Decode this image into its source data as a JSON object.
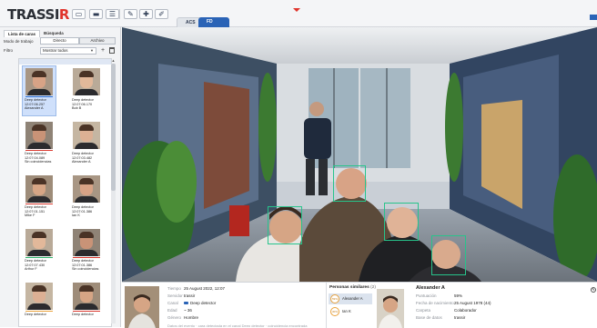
{
  "app": {
    "logo_main": "TRASSI",
    "logo_accent": "R"
  },
  "toolbar": {
    "buttons": [
      {
        "name": "layout-icon",
        "glyph": "▭"
      },
      {
        "name": "monitor-icon",
        "glyph": "▬"
      },
      {
        "name": "list-icon",
        "glyph": "☰"
      },
      {
        "name": "tools-icon",
        "glyph": "✎"
      },
      {
        "name": "puzzle-icon",
        "glyph": "✚"
      },
      {
        "name": "pencil-square-icon",
        "glyph": "✐"
      }
    ],
    "server_tabs": [
      "ACS",
      "FD"
    ]
  },
  "left_panel": {
    "tabs": [
      "Lista de caras",
      "Búsqueda"
    ],
    "mode_label": "Modo de trabajo",
    "mode_options": [
      "Directo",
      "Archivo"
    ],
    "filter_label": "Filtro",
    "filter_value": "Mostrar todos",
    "events": [
      {
        "line1": "Deep detector",
        "line2": "12:07:06.257",
        "line3": "Alexander A",
        "status_color": "#2f6fd0",
        "selected": true
      },
      {
        "line1": "Deep detector",
        "line2": "12:07:06.170",
        "line3": "Bob B",
        "status_color": "#ffffff",
        "selected": false
      },
      {
        "line1": "Deep detector",
        "line2": "12:07:04.089",
        "line3": "Sin coincidencias",
        "status_color": "#d9382e",
        "selected": false
      },
      {
        "line1": "Deep detector",
        "line2": "12:07:03.482",
        "line3": "Alexander A",
        "status_color": "#ffffff",
        "selected": false
      },
      {
        "line1": "Deep detector",
        "line2": "12:07:01.151",
        "line3": "Mike F",
        "status_color": "#d9382e",
        "selected": false
      },
      {
        "line1": "Deep detector",
        "line2": "12:07:01.386",
        "line3": "Ian K",
        "status_color": "#ffffff",
        "selected": false
      },
      {
        "line1": "Deep detector",
        "line2": "12:07:07.430",
        "line3": "Arthur F",
        "status_color": "#2fb36b",
        "selected": false
      },
      {
        "line1": "Deep detector",
        "line2": "12:07:01.386",
        "line3": "Sin coincidencias",
        "status_color": "#d9382e",
        "selected": false
      },
      {
        "line1": "Deep detector",
        "line2": "",
        "line3": "",
        "status_color": "#e9a23b",
        "selected": false
      },
      {
        "line1": "Deep detector",
        "line2": "",
        "line3": "",
        "status_color": "#d9382e",
        "selected": false
      }
    ]
  },
  "bottom_panel": {
    "fields": [
      {
        "label": "Tiempo",
        "value": "25 August 2022, 12:07"
      },
      {
        "label": "Servidor",
        "value": "trassir"
      },
      {
        "label": "Canal",
        "value": "Deep detector"
      },
      {
        "label": "Edad",
        "value": "~ 36"
      },
      {
        "label": "Género",
        "value": "Hombre"
      }
    ],
    "blurred_text": "Datos del evento · cara detectada en el canal Deep detector · coincidencia encontrada",
    "similar_title": "Personas similares",
    "similar_count": "(2)",
    "similar_people": [
      {
        "percent": "59%",
        "name": "Alexander A",
        "selected": true
      },
      {
        "percent": "30%",
        "name": "Ian K",
        "selected": false
      }
    ],
    "person": {
      "name": "Alexander A",
      "details": [
        {
          "label": "Puntuación",
          "value": "59%"
        },
        {
          "label": "Fecha de nacimiento",
          "value": "25 August 1978 (44)"
        },
        {
          "label": "Carpeta",
          "value": "Colaborador"
        },
        {
          "label": "Base de datos",
          "value": "trassir"
        }
      ]
    }
  }
}
